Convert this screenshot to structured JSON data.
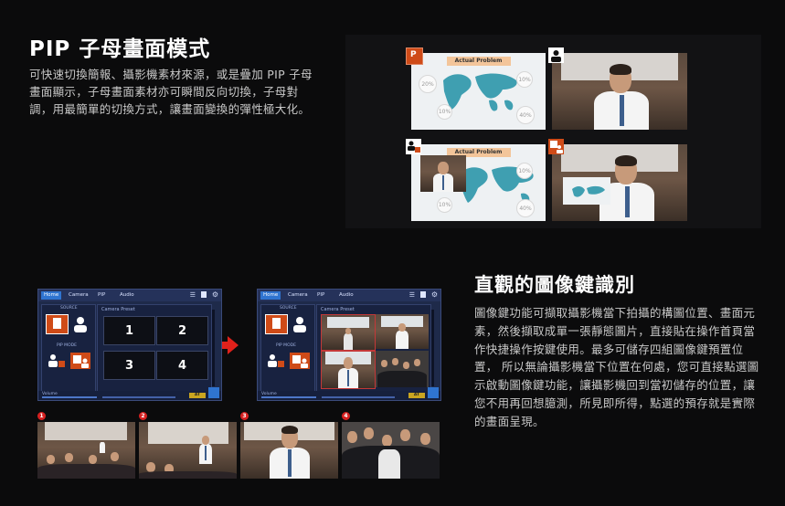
{
  "section1": {
    "title": "PIP 子母畫面模式",
    "description": "可快速切換簡報、攝影機素材來源，或是疊加 PIP 子母畫面顯示，子母畫面素材亦可瞬間反向切換，子母對調，用最簡單的切換方式，讓畫面變換的彈性極大化。"
  },
  "section2": {
    "title": "直觀的圖像鍵識別",
    "description": "圖像鍵功能可擷取攝影機當下拍攝的構圖位置、畫面元素，然後擷取成單一張靜態圖片，直接貼在操作首頁當作快捷操作按鍵使用。最多可儲存四組圖像鍵預置位置， 所以無論攝影機當下位置在何處，您可直接點選圖示啟動圖像鍵功能，讓攝影機回到當初儲存的位置，讓您不用再回想臆測，所見即所得，點選的預存就是實際的畫面呈現。"
  },
  "pip_examples": {
    "slide_title": "Actual Problem",
    "percent_a": "20%",
    "percent_b": "10%",
    "percent_c": "10%",
    "percent_d": "40%",
    "ppt_glyph": "P"
  },
  "ui_panel": {
    "tabs": [
      "Home",
      "Camera",
      "PIP",
      "Audio"
    ],
    "source_label": "SOURCE",
    "pip_mode_label": "PIP MODE",
    "preset_label": "Camera Preset",
    "preset_slots": [
      "1",
      "2",
      "3",
      "4"
    ],
    "volume_label": "Volume",
    "brand": "AT"
  },
  "preset_numbers": [
    "1",
    "2",
    "3",
    "4"
  ],
  "colors": {
    "accent_red": "#e0211b",
    "ui_blue": "#2f74d0",
    "ppt_orange": "#cf4b18"
  }
}
